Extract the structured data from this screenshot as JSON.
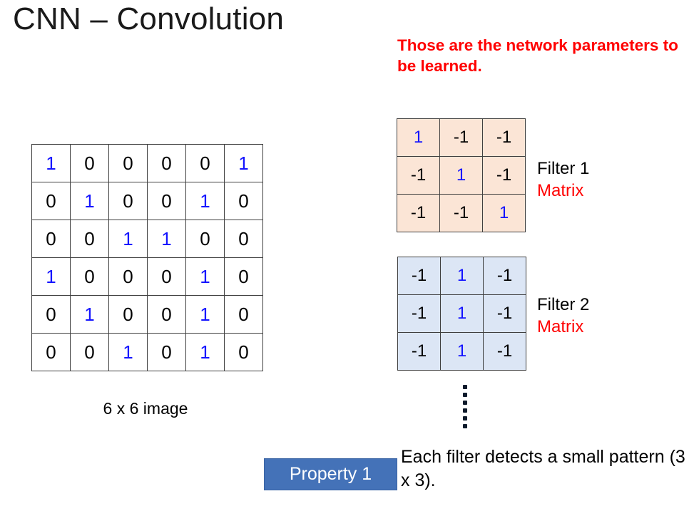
{
  "slide": {
    "title": "CNN – Convolution",
    "network_note": "Those are the network parameters to be learned."
  },
  "image_matrix": {
    "caption": "6 x 6 image",
    "rows": [
      [
        "1",
        "0",
        "0",
        "0",
        "0",
        "1"
      ],
      [
        "0",
        "1",
        "0",
        "0",
        "1",
        "0"
      ],
      [
        "0",
        "0",
        "1",
        "1",
        "0",
        "0"
      ],
      [
        "1",
        "0",
        "0",
        "0",
        "1",
        "0"
      ],
      [
        "0",
        "1",
        "0",
        "0",
        "1",
        "0"
      ],
      [
        "0",
        "0",
        "1",
        "0",
        "1",
        "0"
      ]
    ]
  },
  "filters": [
    {
      "name": "Filter 1",
      "kind": "Matrix",
      "background": "#fbe5d6",
      "rows": [
        [
          "1",
          "-1",
          "-1"
        ],
        [
          "-1",
          "1",
          "-1"
        ],
        [
          "-1",
          "-1",
          "1"
        ]
      ]
    },
    {
      "name": "Filter 2",
      "kind": "Matrix",
      "background": "#dce6f5",
      "rows": [
        [
          "-1",
          "1",
          "-1"
        ],
        [
          "-1",
          "1",
          "-1"
        ],
        [
          "-1",
          "1",
          "-1"
        ]
      ]
    }
  ],
  "ellipsis": {
    "dots": 6
  },
  "property": {
    "badge_label": "Property 1",
    "description": "Each filter detects a small pattern (3 x 3).",
    "badge_color": "#4472b8"
  },
  "colors": {
    "one_value": "#1414ff",
    "zero_value": "#000000",
    "highlight_red": "#ff0000",
    "title": "#1a1a1a"
  }
}
